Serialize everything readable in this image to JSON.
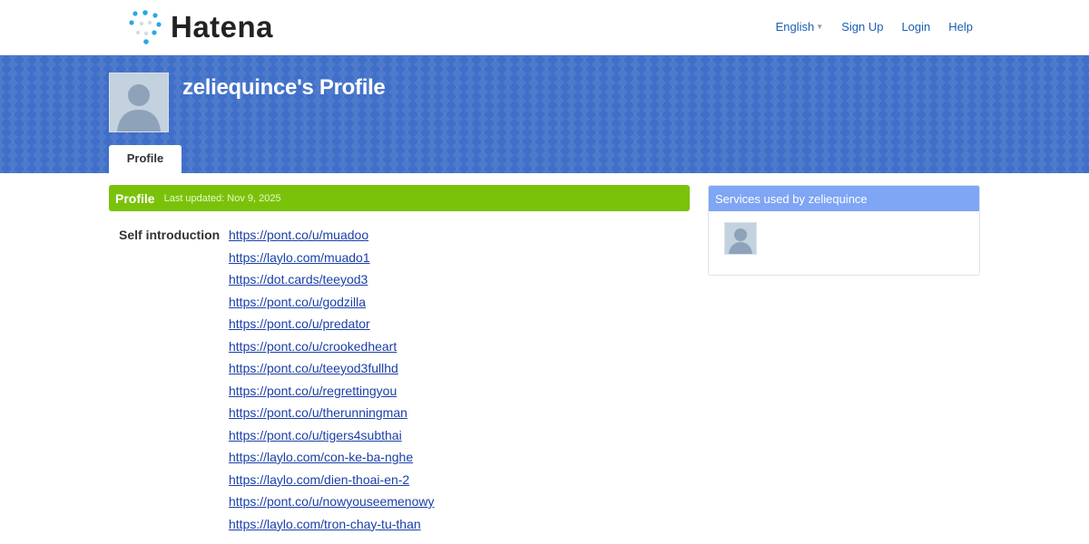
{
  "header": {
    "logo_text": "Hatena",
    "nav": {
      "language": "English",
      "signup": "Sign Up",
      "login": "Login",
      "help": "Help"
    }
  },
  "profile": {
    "title": "zeliequince's Profile",
    "tab_label": "Profile"
  },
  "section": {
    "title": "Profile",
    "updated": "Last updated: Nov 9, 2025"
  },
  "intro": {
    "label": "Self introduction",
    "links": [
      "https://pont.co/u/muadoo",
      "https://laylo.com/muado1",
      "https://dot.cards/teeyod3",
      "https://pont.co/u/godzilla",
      "https://pont.co/u/predator",
      "https://pont.co/u/crookedheart",
      "https://pont.co/u/teeyod3fullhd",
      "https://pont.co/u/regrettingyou",
      "https://pont.co/u/therunningman",
      "https://pont.co/u/tigers4subthai",
      "https://laylo.com/con-ke-ba-nghe",
      "https://laylo.com/dien-thoai-en-2",
      "https://pont.co/u/nowyouseemenowy",
      "https://laylo.com/tron-chay-tu-than"
    ]
  },
  "side": {
    "title": "Services used by zeliequince"
  },
  "colors": {
    "banner": "#3f6fc8",
    "section_green": "#7ac20a",
    "side_header": "#7fa5f5",
    "link": "#1a3fa8"
  }
}
